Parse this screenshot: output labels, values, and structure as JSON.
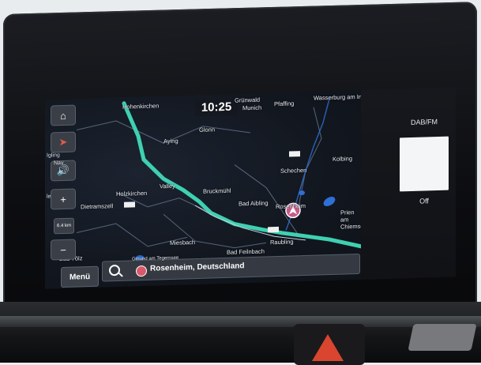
{
  "map": {
    "clock": "10:25",
    "places": [
      {
        "name": "Hohenkirchen"
      },
      {
        "name": "Grünwald"
      },
      {
        "name": "Aying"
      },
      {
        "name": "Glonn"
      },
      {
        "name": "Valley"
      },
      {
        "name": "Holzkirchen"
      },
      {
        "name": "Bruckmühl"
      },
      {
        "name": "Bad Aibling"
      },
      {
        "name": "Dietramszell"
      },
      {
        "name": "Miesbach"
      },
      {
        "name": "Bad Feilnbach"
      },
      {
        "name": "Gmund am Tegernsee"
      },
      {
        "name": "Pfaffing"
      },
      {
        "name": "Wasserburg am Inn"
      },
      {
        "name": "Schechen"
      },
      {
        "name": "Rosenheim"
      },
      {
        "name": "Kolbing"
      },
      {
        "name": "Raubling"
      },
      {
        "name": "Prien am Chiemsee"
      },
      {
        "name": "Bad Tölz"
      },
      {
        "name": "Munich"
      },
      {
        "name": "Igling"
      },
      {
        "name": "led"
      }
    ],
    "nav_label": "Nav",
    "zoom_level": "6.4 km"
  },
  "buttons": {
    "home_icon": "home-icon",
    "compass_icon": "compass-icon",
    "volume_icon": "volume-icon",
    "zoom_in_label": "+",
    "zoom_out_label": "−",
    "menu_label": "Menü"
  },
  "search": {
    "destination": "Rosenheim, Deutschland"
  },
  "dab": {
    "title": "DAB/FM",
    "status": "Off"
  },
  "colors": {
    "route": "#3fd0b2",
    "water": "#2f6fd6",
    "road": "#c8d0dc"
  }
}
